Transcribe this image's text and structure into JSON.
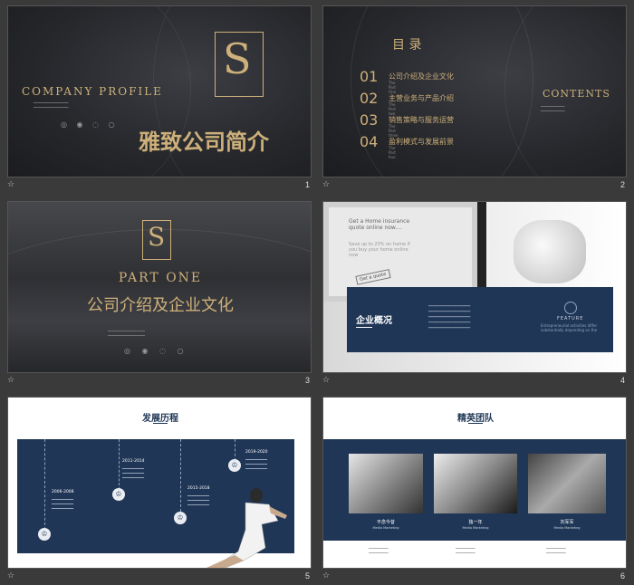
{
  "slides": [
    {
      "num": "1",
      "company_profile": "COMPANY PROFILE",
      "title": "雅致公司简介",
      "logo_letter": "S"
    },
    {
      "num": "2",
      "heading": "目 录",
      "contents_label": "CONTENTS",
      "items": [
        {
          "n": "01",
          "label": "公司介绍及企业文化",
          "sub": "The Part One"
        },
        {
          "n": "02",
          "label": "主营业务与产品介绍",
          "sub": "The Part two"
        },
        {
          "n": "03",
          "label": "销售策略与服务运营",
          "sub": "The Part three"
        },
        {
          "n": "04",
          "label": "盈利模式与发展前景",
          "sub": "The Part four"
        }
      ]
    },
    {
      "num": "3",
      "part": "PART ONE",
      "title": "公司介绍及企业文化",
      "logo_letter": "S"
    },
    {
      "num": "4",
      "section": "企业概况",
      "feature": "FEATURE",
      "feature_sub": "Entrepreneurial activities differ substantially depending on the",
      "screen_text1": "Get a Home insurance quote online now....",
      "screen_text2": "Save up to 20% on home if you buy your home online now",
      "screen_button": "Get a quote"
    },
    {
      "num": "5",
      "title": "发展历程",
      "milestones": [
        "2006-2008",
        "2011-2014",
        "2015-2018",
        "2019-2020"
      ]
    },
    {
      "num": "6",
      "title": "精英团队",
      "members": [
        {
          "name": "不念今昔",
          "role": "Media Marketing"
        },
        {
          "name": "独一年",
          "role": "Media Marketing"
        },
        {
          "name": "刘军军",
          "role": "Media Marketing"
        }
      ]
    }
  ]
}
